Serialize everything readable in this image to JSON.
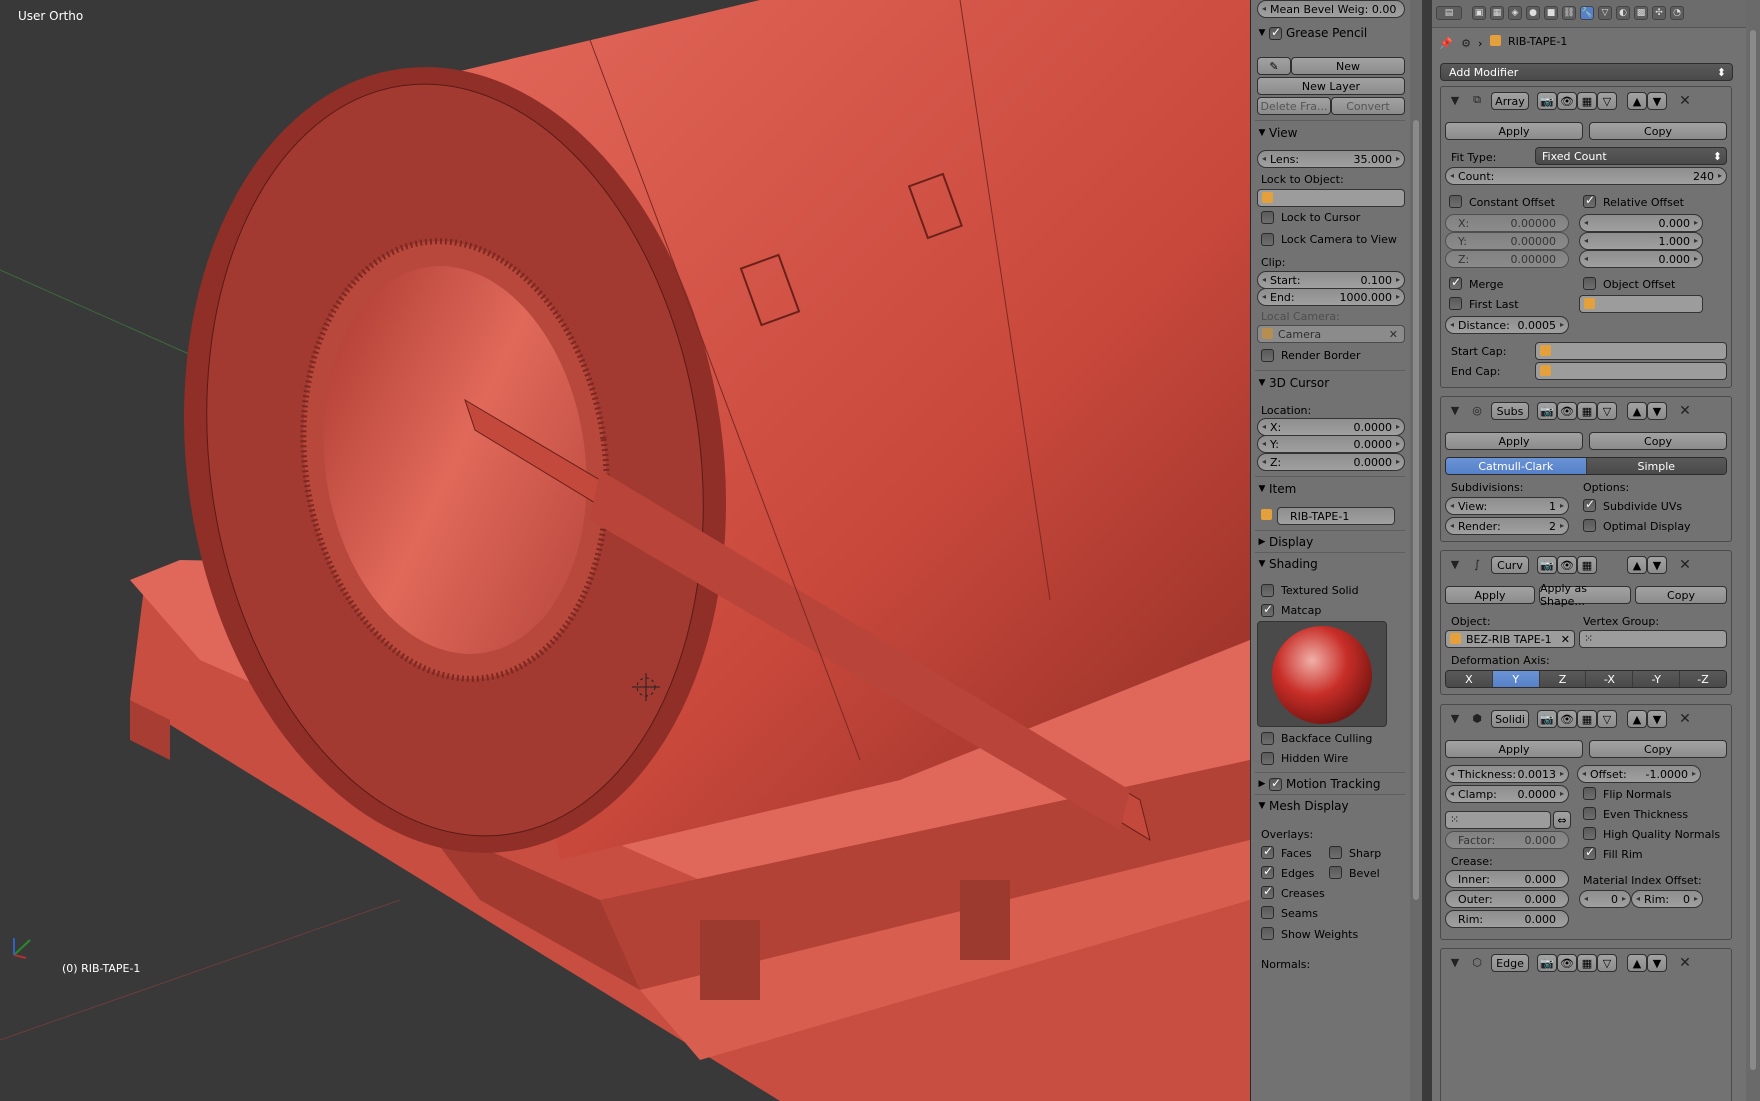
{
  "viewport": {
    "view_label": "User Ortho",
    "object_label": "(0) RIB-TAPE-1"
  },
  "npanel": {
    "top_field": "Mean Bevel Weig: 0.00",
    "grease_pencil": {
      "title": "Grease Pencil",
      "new": "New",
      "new_layer": "New Layer",
      "delete_frame": "Delete Fra...",
      "convert": "Convert"
    },
    "view": {
      "title": "View",
      "lens_label": "Lens:",
      "lens_value": "35.000",
      "lock_to_object": "Lock to Object:",
      "lock_to_cursor": "Lock to Cursor",
      "lock_camera": "Lock Camera to View",
      "clip": "Clip:",
      "start_label": "Start:",
      "start_value": "0.100",
      "end_label": "End:",
      "end_value": "1000.000",
      "local_camera": "Local Camera:",
      "camera": "Camera",
      "render_border": "Render Border"
    },
    "cursor": {
      "title": "3D Cursor",
      "location": "Location:",
      "x_label": "X:",
      "x_value": "0.0000",
      "y_label": "Y:",
      "y_value": "0.0000",
      "z_label": "Z:",
      "z_value": "0.0000"
    },
    "item": {
      "title": "Item",
      "name": "RIB-TAPE-1"
    },
    "display": {
      "title": "Display"
    },
    "shading": {
      "title": "Shading",
      "textured_solid": "Textured Solid",
      "matcap": "Matcap",
      "backface": "Backface Culling",
      "hidden_wire": "Hidden Wire"
    },
    "motion_tracking": {
      "title": "Motion Tracking"
    },
    "mesh_display": {
      "title": "Mesh Display",
      "overlays": "Overlays:",
      "faces": "Faces",
      "sharp": "Sharp",
      "edges": "Edges",
      "bevel": "Bevel",
      "creases": "Creases",
      "seams": "Seams",
      "show_weights": "Show Weights",
      "normals": "Normals:"
    }
  },
  "props": {
    "object_name": "RIB-TAPE-1",
    "add_modifier": "Add Modifier",
    "array": {
      "name": "Array",
      "apply": "Apply",
      "copy": "Copy",
      "fit_type_label": "Fit Type:",
      "fit_type_value": "Fixed Count",
      "count_label": "Count:",
      "count_value": "240",
      "constant_offset": "Constant Offset",
      "relative_offset": "Relative Offset",
      "cx_label": "X:",
      "cx_value": "0.00000",
      "cy_label": "Y:",
      "cy_value": "0.00000",
      "cz_label": "Z:",
      "cz_value": "0.00000",
      "rx_value": "0.000",
      "ry_value": "1.000",
      "rz_value": "0.000",
      "merge": "Merge",
      "object_offset": "Object Offset",
      "first_last": "First Last",
      "distance_label": "Distance:",
      "distance_value": "0.0005",
      "start_cap": "Start Cap:",
      "end_cap": "End Cap:"
    },
    "subsurf": {
      "name": "Subs",
      "apply": "Apply",
      "copy": "Copy",
      "catmull": "Catmull-Clark",
      "simple": "Simple",
      "subdivisions": "Subdivisions:",
      "options": "Options:",
      "view_label": "View:",
      "view_value": "1",
      "render_label": "Render:",
      "render_value": "2",
      "subdivide_uvs": "Subdivide UVs",
      "optimal_display": "Optimal Display"
    },
    "curve": {
      "name": "Curv",
      "apply": "Apply",
      "apply_shape": "Apply as Shape...",
      "copy": "Copy",
      "object_label": "Object:",
      "object_value": "BEZ-RIB TAPE-1",
      "vertex_group": "Vertex Group:",
      "deform_axis": "Deformation Axis:",
      "axes": [
        "X",
        "Y",
        "Z",
        "-X",
        "-Y",
        "-Z"
      ]
    },
    "solidify": {
      "name": "Solidi",
      "apply": "Apply",
      "copy": "Copy",
      "thickness_label": "Thickness:",
      "thickness_value": "0.0013",
      "offset_label": "Offset:",
      "offset_value": "-1.0000",
      "clamp_label": "Clamp:",
      "clamp_value": "0.0000",
      "flip_normals": "Flip Normals",
      "even_thickness": "Even Thickness",
      "high_quality": "High Quality Normals",
      "fill_rim": "Fill Rim",
      "factor_label": "Factor:",
      "factor_value": "0.000",
      "crease": "Crease:",
      "inner_label": "Inner:",
      "inner_value": "0.000",
      "outer_label": "Outer:",
      "outer_value": "0.000",
      "rim_label": "Rim:",
      "rim_value": "0.000",
      "mat_index": "Material Index Offset:",
      "mat_value": "0",
      "mat_rim_label": "Rim:",
      "mat_rim_value": "0"
    },
    "edge": {
      "name": "Edge"
    }
  },
  "colors": {
    "object": "#d9574b",
    "selection": "#5680c8",
    "panel": "#727272"
  }
}
